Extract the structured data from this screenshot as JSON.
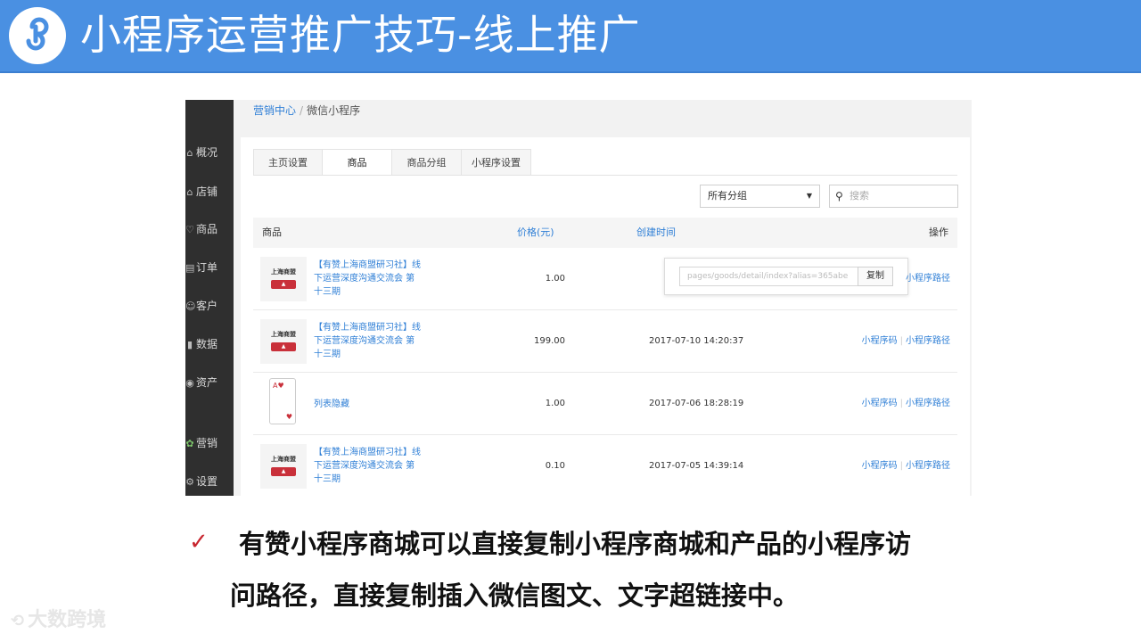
{
  "banner": {
    "title": "小程序运营推广技巧-线上推广",
    "color": "#4a90e2"
  },
  "breadcrumb": {
    "parent": "营销中心",
    "separator": "/",
    "current": "微信小程序"
  },
  "sidebar": {
    "items": [
      {
        "icon": "home-icon",
        "glyph": "⌂",
        "label": "概况"
      },
      {
        "icon": "store-icon",
        "glyph": "⌂",
        "label": "店铺"
      },
      {
        "icon": "tag-icon",
        "glyph": "♡",
        "label": "商品"
      },
      {
        "icon": "order-icon",
        "glyph": "▤",
        "label": "订单"
      },
      {
        "icon": "customer-icon",
        "glyph": "☺",
        "label": "客户"
      },
      {
        "icon": "chart-icon",
        "glyph": "▮",
        "label": "数据"
      },
      {
        "icon": "asset-icon",
        "glyph": "◉",
        "label": "资产"
      },
      {
        "icon": "marketing-icon",
        "glyph": "✿",
        "label": "营销"
      },
      {
        "icon": "settings-icon",
        "glyph": "⚙",
        "label": "设置"
      }
    ]
  },
  "tabs": [
    "主页设置",
    "商品",
    "商品分组",
    "小程序设置"
  ],
  "filter": {
    "group_select": "所有分组",
    "search_placeholder": "搜索"
  },
  "table": {
    "headers": {
      "goods": "商品",
      "price": "价格(元)",
      "time": "创建时间",
      "op": "操作"
    },
    "rows": [
      {
        "thumb": "上海商盟",
        "name": "【有赞上海商盟研习社】线下运营深度沟通交流会 第十三期",
        "price": "1.00",
        "time": "",
        "op1": "",
        "op2": "小程序路径"
      },
      {
        "thumb": "上海商盟",
        "name": "【有赞上海商盟研习社】线下运营深度沟通交流会 第十三期",
        "price": "199.00",
        "time": "2017-07-10 14:20:37",
        "op1": "小程序码",
        "op2": "小程序路径"
      },
      {
        "thumb": "card",
        "name": "列表隐藏",
        "price": "1.00",
        "time": "2017-07-06 18:28:19",
        "op1": "小程序码",
        "op2": "小程序路径"
      },
      {
        "thumb": "上海商盟",
        "name": "【有赞上海商盟研习社】线下运营深度沟通交流会 第十三期",
        "price": "0.10",
        "time": "2017-07-05 14:39:14",
        "op1": "小程序码",
        "op2": "小程序路径"
      }
    ]
  },
  "popover": {
    "path_value": "pages/goods/detail/index?alias=365abe",
    "copy_label": "复制"
  },
  "caption": {
    "mark": "✓",
    "line1": "有赞小程序商城可以直接复制小程序商城和产品的小程序访",
    "line2": "问路径，直接复制插入微信图文、文字超链接中。"
  },
  "watermark": "大数跨境"
}
